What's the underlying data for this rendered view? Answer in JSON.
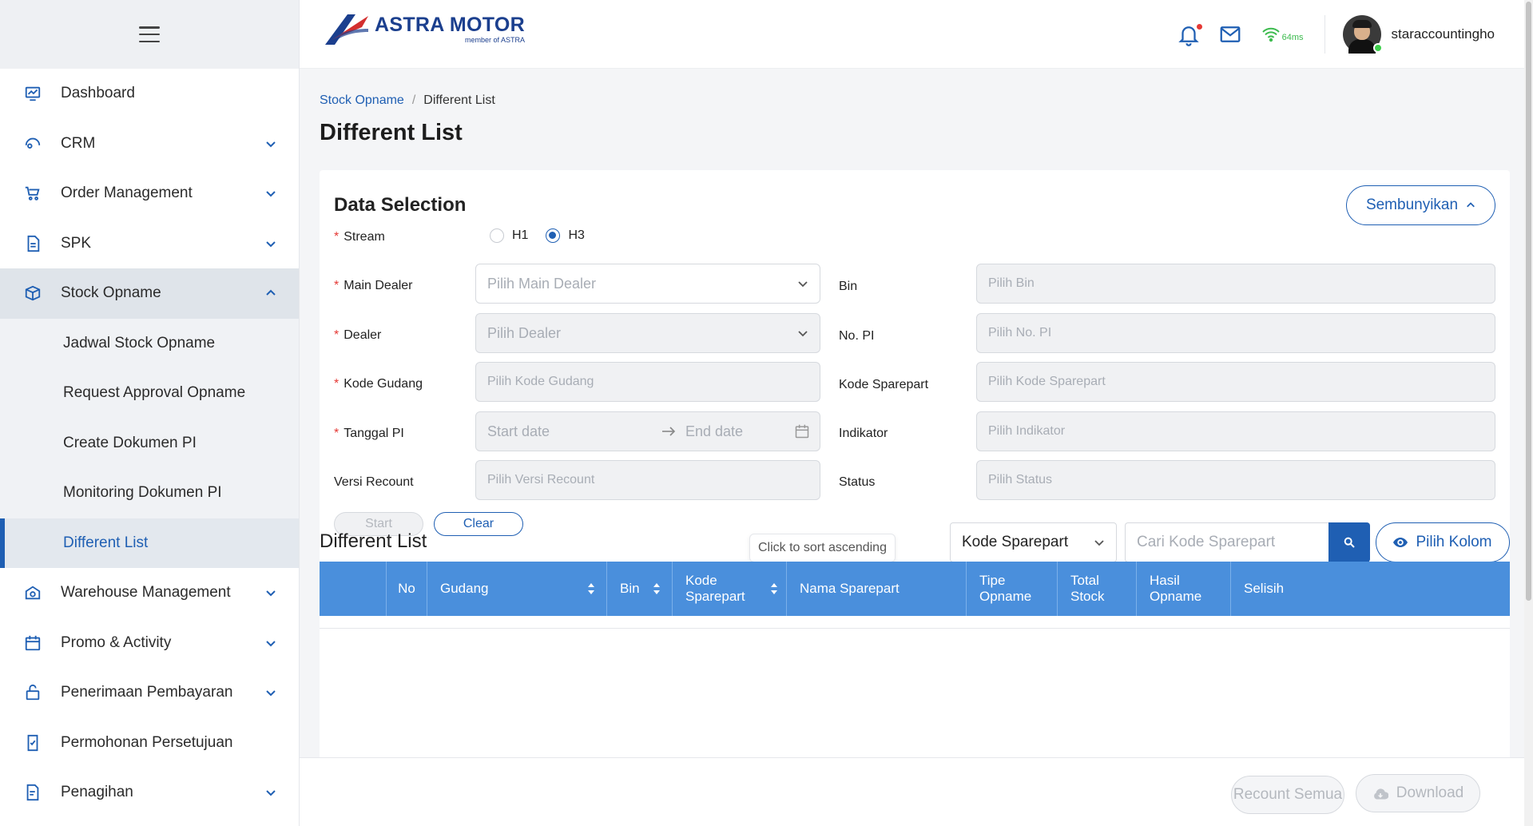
{
  "header": {
    "logo_title": "ASTRA MOTOR",
    "logo_subtitle": "member of ASTRA",
    "latency": "64ms",
    "username": "staraccountingho"
  },
  "sidebar": {
    "items": [
      {
        "label": "Dashboard",
        "icon": "dashboard-icon"
      },
      {
        "label": "CRM",
        "icon": "crm-icon"
      },
      {
        "label": "Order Management",
        "icon": "cart-icon"
      },
      {
        "label": "SPK",
        "icon": "document-icon"
      },
      {
        "label": "Stock Opname",
        "icon": "box-icon"
      },
      {
        "label": "Warehouse Management",
        "icon": "warehouse-icon"
      },
      {
        "label": "Promo & Activity",
        "icon": "calendar-icon"
      },
      {
        "label": "Penerimaan Pembayaran",
        "icon": "payment-icon"
      },
      {
        "label": "Permohonan Persetujuan",
        "icon": "approval-icon"
      },
      {
        "label": "Penagihan",
        "icon": "billing-icon"
      }
    ],
    "stock_opname_sub": [
      {
        "label": "Jadwal Stock Opname"
      },
      {
        "label": "Request Approval Opname"
      },
      {
        "label": "Create Dokumen PI"
      },
      {
        "label": "Monitoring Dokumen PI"
      },
      {
        "label": "Different List"
      }
    ]
  },
  "breadcrumb": {
    "parent": "Stock Opname",
    "separator": "/",
    "current": "Different List"
  },
  "page_title": "Different List",
  "data_selection": {
    "title": "Data Selection",
    "hide_button": "Sembunyikan",
    "stream_label": "Stream",
    "stream_options": [
      "H1",
      "H3"
    ],
    "stream_selected": "H3",
    "main_dealer_label": "Main Dealer",
    "main_dealer_placeholder": "Pilih Main Dealer",
    "dealer_label": "Dealer",
    "dealer_placeholder": "Pilih Dealer",
    "kode_gudang_label": "Kode Gudang",
    "kode_gudang_placeholder": "Pilih Kode Gudang",
    "tanggal_pi_label": "Tanggal PI",
    "start_date_placeholder": "Start date",
    "end_date_placeholder": "End date",
    "versi_recount_label": "Versi Recount",
    "versi_recount_placeholder": "Pilih Versi Recount",
    "bin_label": "Bin",
    "bin_placeholder": "Pilih Bin",
    "no_pi_label": "No. PI",
    "no_pi_placeholder": "Pilih No. PI",
    "kode_sparepart_label": "Kode Sparepart",
    "kode_sparepart_placeholder": "Pilih Kode Sparepart",
    "indikator_label": "Indikator",
    "indikator_placeholder": "Pilih Indikator",
    "status_label": "Status",
    "status_placeholder": "Pilih Status",
    "start_button": "Start",
    "clear_button": "Clear"
  },
  "different_list": {
    "title": "Different List",
    "search_column": "Kode Sparepart",
    "search_placeholder": "Cari Kode Sparepart",
    "pilih_kolom": "Pilih Kolom",
    "tooltip": "Click to sort ascending",
    "columns": [
      "",
      "No",
      "Gudang",
      "Bin",
      "Kode Sparepart",
      "Nama Sparepart",
      "Tipe Opname",
      "Total Stock",
      "Hasil Opname",
      "Selisih"
    ]
  },
  "footer": {
    "recount_button": "Recount Semua",
    "download_button": "Download"
  },
  "colors": {
    "primary": "#1f5fb3",
    "table_header": "#4a8fdc",
    "required": "#e53935",
    "online": "#3ecf4c"
  }
}
